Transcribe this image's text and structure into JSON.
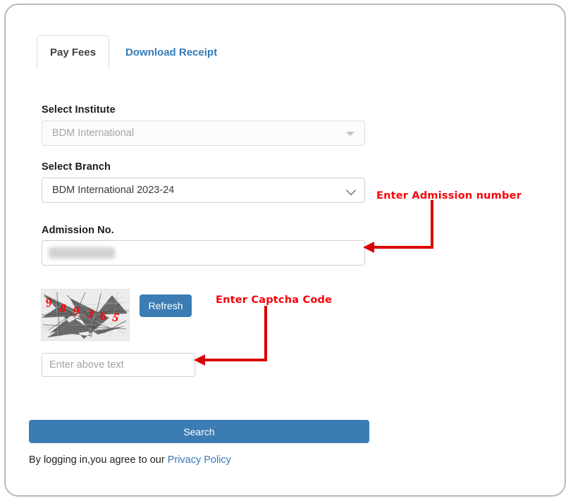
{
  "tabs": [
    {
      "label": "Pay Fees",
      "active": true
    },
    {
      "label": "Download Receipt",
      "active": false
    }
  ],
  "form": {
    "institute": {
      "label": "Select Institute",
      "value": "BDM International",
      "disabled": true
    },
    "branch": {
      "label": "Select Branch",
      "value": "BDM International 2023-24",
      "options": [
        "BDM International 2023-24"
      ]
    },
    "admission": {
      "label": "Admission No.",
      "value": "",
      "placeholder": "",
      "redacted": true
    }
  },
  "captcha": {
    "code": "989365",
    "digits": [
      "9",
      "8",
      "9",
      "3",
      "6",
      "5"
    ],
    "refresh_label": "Refresh",
    "input_placeholder": "Enter above text",
    "input_value": ""
  },
  "actions": {
    "search_label": "Search"
  },
  "footer": {
    "text": "By logging in,you agree to our ",
    "link_label": "Privacy Policy"
  },
  "annotations": [
    {
      "id": "admission",
      "text": "Enter Admission number"
    },
    {
      "id": "captcha",
      "text": "Enter Captcha Code"
    }
  ],
  "colors": {
    "primary_blue": "#3b7cb5",
    "link_blue": "#337ab7",
    "annotation_red": "#fb0007",
    "captcha_red": "#fb0007",
    "card_border": "#b9b9b9"
  }
}
